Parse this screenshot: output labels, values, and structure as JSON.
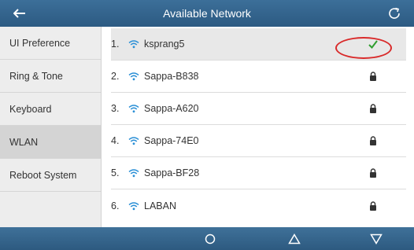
{
  "header": {
    "title": "Available Network",
    "back_icon": "arrow-left-icon",
    "refresh_icon": "refresh-icon"
  },
  "sidebar": {
    "items": [
      {
        "label": "UI Preference"
      },
      {
        "label": "Ring & Tone"
      },
      {
        "label": "Keyboard"
      },
      {
        "label": "WLAN"
      },
      {
        "label": "Reboot System"
      }
    ],
    "active": "WLAN"
  },
  "networks": [
    {
      "num": "1.",
      "name": "ksprang5",
      "status_icon": "check-icon"
    },
    {
      "num": "2.",
      "name": "Sappa-B838",
      "status_icon": "lock-icon"
    },
    {
      "num": "3.",
      "name": "Sappa-A620",
      "status_icon": "lock-icon"
    },
    {
      "num": "4.",
      "name": "Sappa-74E0",
      "status_icon": "lock-icon"
    },
    {
      "num": "5.",
      "name": "Sappa-BF28",
      "status_icon": "lock-icon"
    },
    {
      "num": "6.",
      "name": "LABAN",
      "status_icon": "lock-icon"
    }
  ],
  "nav_bar": {
    "home_icon": "circle-home-icon",
    "up_icon": "triangle-up-icon",
    "down_icon": "triangle-down-icon"
  },
  "colors": {
    "header_bg": "#2c5a82",
    "wifi_icon": "#2a8fd6",
    "check": "#2f9e2f",
    "annotation_circle": "#d92b2b"
  }
}
